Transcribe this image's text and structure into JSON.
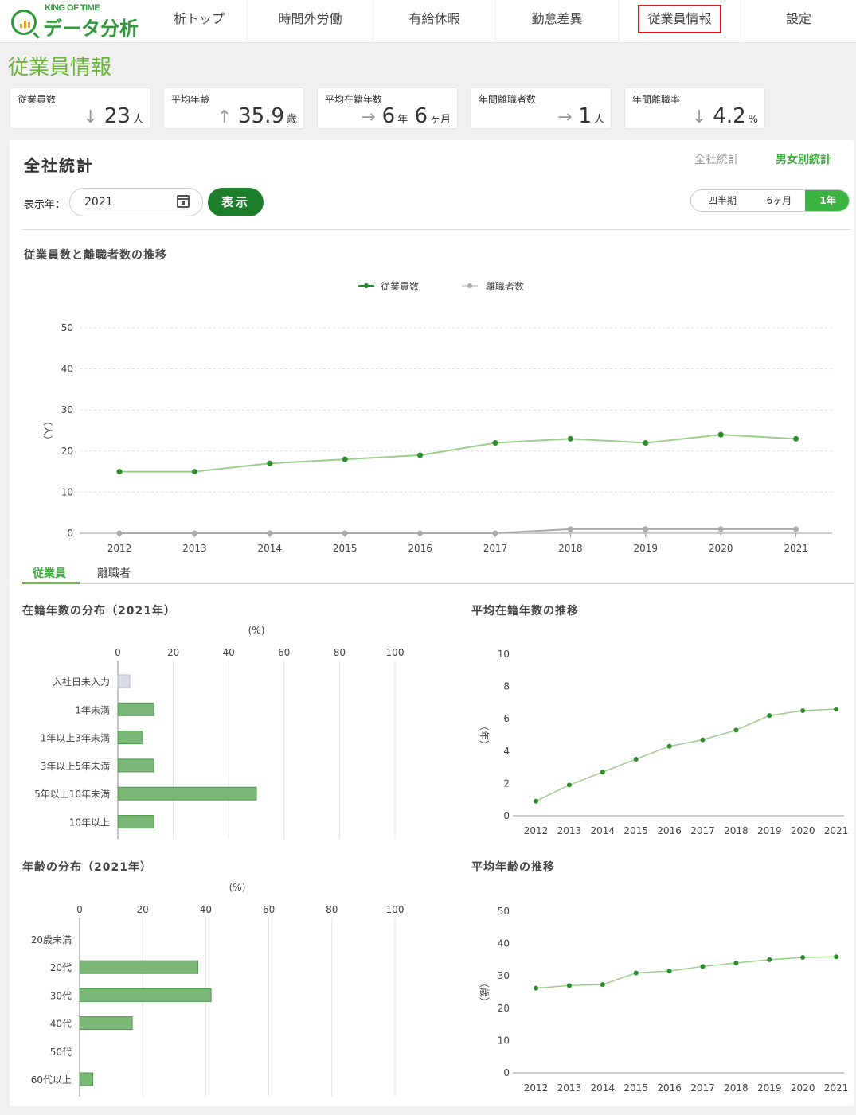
{
  "header": {
    "logo_top": "KING OF TIME",
    "logo_main": "データ分析",
    "nav": [
      {
        "label": "析トップ"
      },
      {
        "label": "時間外労働"
      },
      {
        "label": "有給休暇"
      },
      {
        "label": "勤怠差異"
      },
      {
        "label": "従業員情報"
      },
      {
        "label": "設定"
      }
    ]
  },
  "page_title": "従業員情報",
  "stats": [
    {
      "label": "従業員数",
      "arrow": "↓",
      "value": "23",
      "unit": "人"
    },
    {
      "label": "平均年齢",
      "arrow": "↑",
      "value": "35.9",
      "unit": "歳"
    },
    {
      "label": "平均在籍年数",
      "arrow": "→",
      "value": "6",
      "unit": "年",
      "value2": "6",
      "unit2": "ヶ月"
    },
    {
      "label": "年間離職者数",
      "arrow": "→",
      "value": "1",
      "unit": "人"
    },
    {
      "label": "年間離職率",
      "arrow": "↓",
      "value": "4.2",
      "unit": "%"
    }
  ],
  "section": {
    "title": "全社統計",
    "toggle_company": "全社統計",
    "toggle_gender": "男女別統計",
    "year_label": "表示年：",
    "year_value": "2021",
    "show_button": "表示",
    "periods": [
      "四半期",
      "6ヶ月",
      "1年"
    ],
    "active_period": "1年"
  },
  "tabs": {
    "employees": "従業員",
    "leavers": "離職者"
  },
  "colors": {
    "accent": "#6db33f",
    "dark_green": "#1d7f2c",
    "bar": "#7bb878",
    "line": "#9ccf8e",
    "point": "#2e8b2e",
    "gray_line": "#aaaaaa"
  },
  "chart_data": [
    {
      "type": "line",
      "title": "従業員数と離職者数の推移",
      "ylabel": "（人）",
      "categories": [
        "2012",
        "2013",
        "2014",
        "2015",
        "2016",
        "2017",
        "2018",
        "2019",
        "2020",
        "2021"
      ],
      "series": [
        {
          "name": "従業員数",
          "values": [
            15,
            15,
            17,
            18,
            19,
            22,
            23,
            22,
            24,
            23
          ]
        },
        {
          "name": "離職者数",
          "values": [
            0,
            0,
            0,
            0,
            0,
            0,
            1,
            1,
            1,
            1
          ]
        }
      ],
      "ylim": [
        0,
        50
      ],
      "yticks": [
        0,
        10,
        20,
        30,
        40,
        50
      ],
      "legend": "top-center",
      "grid": true
    },
    {
      "type": "bar",
      "orientation": "horizontal",
      "title": "在籍年数の分布（2021年）",
      "unit": "(%)",
      "categories": [
        "入社日未入力",
        "1年未満",
        "1年以上3年未満",
        "3年以上5年未満",
        "5年以上10年未満",
        "10年以上"
      ],
      "values": [
        4.3,
        13,
        8.7,
        13,
        50,
        13
      ],
      "xlim": [
        0,
        100
      ],
      "xticks": [
        0,
        20,
        40,
        60,
        80,
        100
      ]
    },
    {
      "type": "line",
      "title": "平均在籍年数の推移",
      "ylabel": "（年）",
      "categories": [
        "2012",
        "2013",
        "2014",
        "2015",
        "2016",
        "2017",
        "2018",
        "2019",
        "2020",
        "2021"
      ],
      "values": [
        0.9,
        1.9,
        2.7,
        3.5,
        4.3,
        4.7,
        5.3,
        6.2,
        6.5,
        6.6
      ],
      "ylim": [
        0,
        10
      ],
      "yticks": [
        0,
        2,
        4,
        6,
        8,
        10
      ]
    },
    {
      "type": "bar",
      "orientation": "horizontal",
      "title": "年齢の分布（2021年）",
      "unit": "(%)",
      "categories": [
        "20歳未満",
        "20代",
        "30代",
        "40代",
        "50代",
        "60代以上"
      ],
      "values": [
        0,
        37.5,
        41.7,
        16.7,
        0,
        4.2
      ],
      "xlim": [
        0,
        100
      ],
      "xticks": [
        0,
        20,
        40,
        60,
        80,
        100
      ]
    },
    {
      "type": "line",
      "title": "平均年齢の推移",
      "ylabel": "（歳）",
      "categories": [
        "2012",
        "2013",
        "2014",
        "2015",
        "2016",
        "2017",
        "2018",
        "2019",
        "2020",
        "2021"
      ],
      "values": [
        26.2,
        27,
        27.3,
        30.9,
        31.5,
        32.9,
        34,
        35,
        35.7,
        35.9
      ],
      "ylim": [
        0,
        50
      ],
      "yticks": [
        0,
        10,
        20,
        30,
        40,
        50
      ]
    }
  ]
}
